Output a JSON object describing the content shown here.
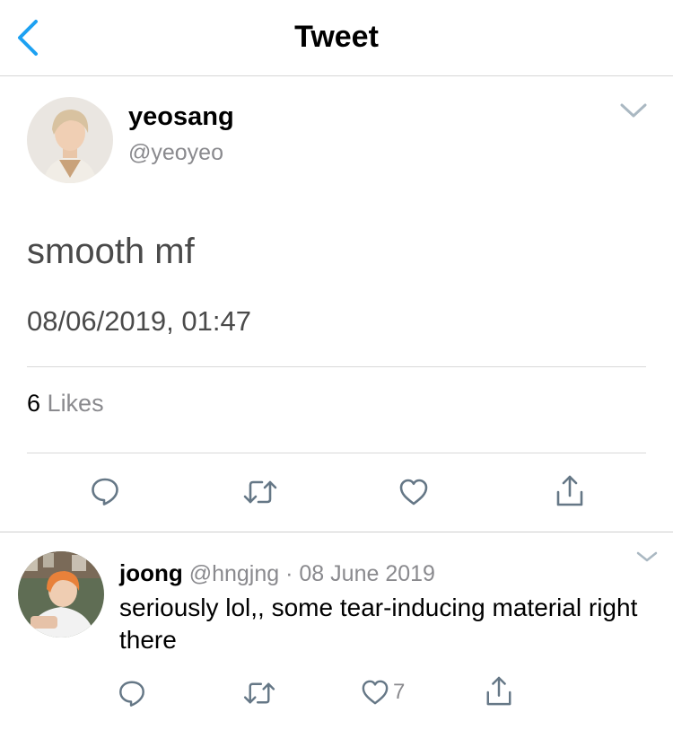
{
  "nav": {
    "title": "Tweet"
  },
  "tweet": {
    "author_name": "yeosang",
    "author_handle": "@yeoyeo",
    "text": "smooth mf",
    "timestamp": "08/06/2019, 01:47",
    "likes_count": "6",
    "likes_label": "Likes"
  },
  "reply": {
    "author_name": "joong",
    "author_handle": "@hngjng",
    "separator": "·",
    "date": "08 June 2019",
    "text": "seriously lol,, some tear-inducing material right there",
    "like_count": "7"
  },
  "colors": {
    "accent": "#1da1f2",
    "icon_gray": "#657786",
    "meta_gray": "#8a8a8e",
    "divider": "#d8d8d8"
  }
}
